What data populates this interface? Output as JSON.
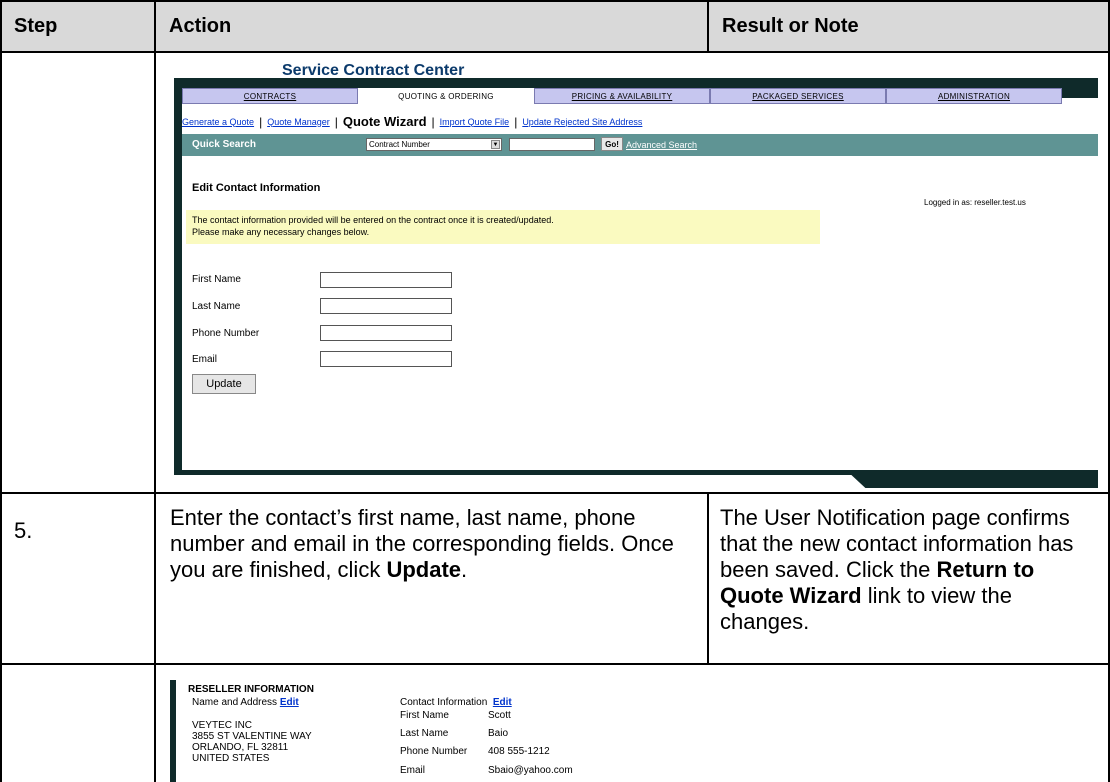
{
  "table": {
    "headers": [
      "Step",
      "Action",
      "Result or Note"
    ],
    "row2": {
      "step": "5.",
      "action_parts": [
        "Enter the contact’s first name, last name, phone number and email in the corresponding fields. Once you are finished, click ",
        "Update",
        "."
      ],
      "result_parts": [
        "The User Notification page confirms that the new contact information has been saved. Click the ",
        "Return to Quote Wizard",
        " link to view the changes."
      ]
    }
  },
  "shot1": {
    "title": "Service Contract Center",
    "tabs": [
      "CONTRACTS",
      "QUOTING & ORDERING",
      "PRICING & AVAILABILITY",
      "PACKAGED SERVICES",
      "ADMINISTRATION"
    ],
    "active_tab": "QUOTING & ORDERING",
    "subnav": [
      "Generate a Quote",
      "Quote Manager",
      "Quote Wizard",
      "Import Quote File",
      "Update Rejected Site Address"
    ],
    "subnav_current": "Quote Wizard",
    "quick_search": {
      "label": "Quick Search",
      "select_value": "Contract Number",
      "go_label": "Go!",
      "advanced": "Advanced Search"
    },
    "page_title": "Edit Contact Information",
    "logged_in": "Logged in as: reseller.test.us",
    "note_lines": [
      "The contact information provided will be entered on the contract once it is created/updated.",
      "Please make any necessary changes below."
    ],
    "fields": [
      "First Name",
      "Last Name",
      "Phone Number",
      "Email"
    ],
    "update_button": "Update"
  },
  "shot2": {
    "heading": "RESELLER INFORMATION",
    "name_address_label": "Name and Address",
    "edit_label": "Edit",
    "address_lines": [
      "VEYTEC INC",
      "3855 ST VALENTINE WAY",
      "ORLANDO, FL 32811",
      "UNITED STATES"
    ],
    "contact_label": "Contact Information",
    "contact_rows": [
      {
        "label": "First Name",
        "value": "Scott"
      },
      {
        "label": "Last Name",
        "value": "Baio"
      },
      {
        "label": "Phone Number",
        "value": "408 555-1212"
      },
      {
        "label": "Email",
        "value": "Sbaio@yahoo.com"
      }
    ]
  },
  "colors": {
    "header_bg": "#d9d9d9",
    "tab_bg": "#c6c6ef",
    "quick_search_bar": "#5f9494",
    "dark_frame": "#0f2a2a",
    "note_bg": "#fafac0",
    "link": "#0033cc"
  }
}
